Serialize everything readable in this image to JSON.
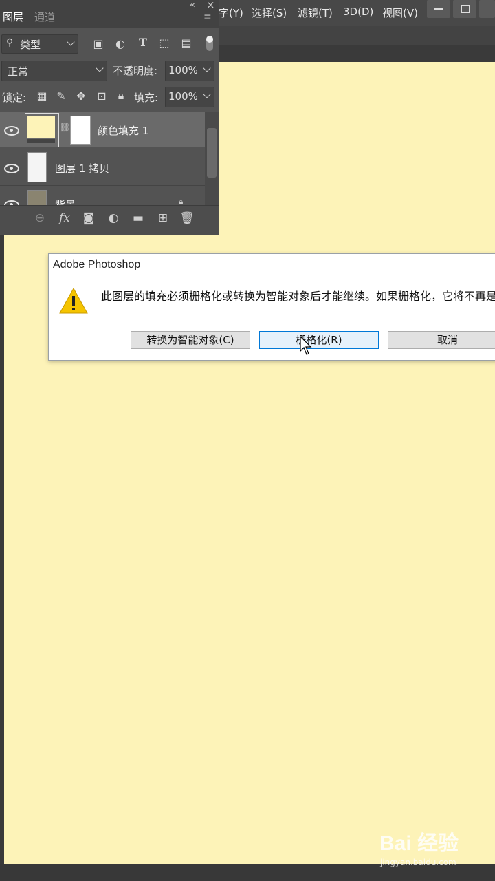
{
  "menu": {
    "items": [
      "字(Y)",
      "选择(S)",
      "滤镜(T)",
      "3D(D)",
      "视图(V)"
    ]
  },
  "layers_panel": {
    "tabs": [
      "图层",
      "通道"
    ],
    "filter_label": "类型",
    "blend_mode": "正常",
    "opacity_label": "不透明度:",
    "opacity_value": "100%",
    "lock_label": "锁定:",
    "fill_label": "填充:",
    "fill_value": "100%",
    "layers": [
      {
        "name": "颜色填充 1",
        "visible": true,
        "selected": true
      },
      {
        "name": "图层 1 拷贝",
        "visible": true,
        "selected": false
      },
      {
        "name": "背景",
        "visible": true,
        "selected": false
      }
    ]
  },
  "dialog": {
    "title": "Adobe Photoshop",
    "message": "此图层的填充必须栅格化或转换为智能对象后才能继续。如果栅格化，它将不再是",
    "buttons": [
      "转换为智能对象(C)",
      "栅格化(R)",
      "取消"
    ]
  },
  "watermark": {
    "logo": "Bai 经验",
    "url": "jingyan.baidu.com"
  },
  "colors": {
    "canvas": "#fdf3b8",
    "panel": "#535353",
    "warning": "#f5c400"
  }
}
